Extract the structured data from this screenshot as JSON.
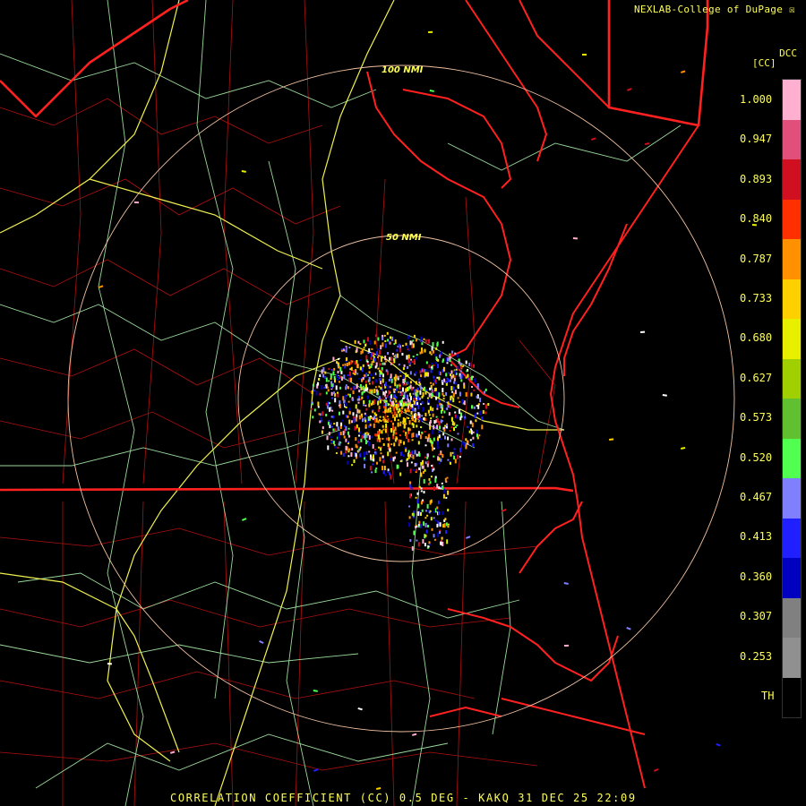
{
  "header": {
    "brand": "NEXLAB-College of DuPage"
  },
  "legend": {
    "product_code": "DCC",
    "unit": "[CC]",
    "ticks": [
      "1.000",
      "0.947",
      "0.893",
      "0.840",
      "0.787",
      "0.733",
      "0.680",
      "0.627",
      "0.573",
      "0.520",
      "0.467",
      "0.413",
      "0.360",
      "0.307",
      "0.253",
      "TH"
    ],
    "colors": [
      "#ffb0d0",
      "#e0507a",
      "#d01020",
      "#ff3000",
      "#ff9000",
      "#ffd000",
      "#e8f000",
      "#a0d000",
      "#60c030",
      "#50ff50",
      "#8080ff",
      "#2020ff",
      "#0000c0",
      "#808080",
      "#909090",
      "#000000"
    ]
  },
  "range_rings": [
    {
      "label": "50 NMI"
    },
    {
      "label": "100 NMI"
    }
  ],
  "footer": {
    "caption": "CORRELATION COEFFICIENT (CC) 0.5 DEG - KAKQ 31 DEC 25 22:09"
  },
  "colors": {
    "state_border": "#ff2020",
    "county_border": "#c01010",
    "highway": "#f0f050",
    "road": "#9ad89a",
    "range_ring": "#f0c0a0"
  }
}
